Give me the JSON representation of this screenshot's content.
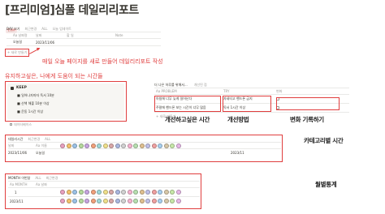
{
  "page": {
    "title": "[프리미엄]심플 데일리리포트",
    "tag": "T기반"
  },
  "daily_db": {
    "tabs": [
      "DAY 보기",
      "최근변경",
      "ALL",
      "오늘 업데이트"
    ],
    "columns": [
      "Aa 날짜명",
      "날짜",
      "할 일",
      "Note"
    ],
    "row": {
      "name": "오늘일",
      "date": "2023/11/06"
    },
    "new_label": "+ 새로 만들기"
  },
  "annotations": {
    "daily_page": "매일 오늘 페이지를 새로 만들어 데일리리포트 작성",
    "keep_time": "유지하고싶은, 나에게 도움이 되는 시간들",
    "improve_time": "개선하고싶은 시간",
    "improve_method": "개선방법",
    "change_record": "변화 기록하기",
    "category_time": "카테고리별 시간",
    "monthly": "월별통계"
  },
  "keep_panel": {
    "title": "KEEP",
    "items": [
      "일어나자마자 독서 10분",
      "산책 해볼 10분 이상",
      "운동 1시간 이상"
    ],
    "footer": "데이터베이스"
  },
  "problem_db": {
    "tabs": [
      "더 나은 하루를 위해서...",
      "개선된 점"
    ],
    "columns": [
      "Aa PROBLEM",
      "TRY",
      "변화"
    ],
    "rows": [
      {
        "problem": "아침에 너무 늦게 일어난다",
        "try": "자네티고 핸드폰 금지",
        "change": ""
      },
      {
        "problem": "주말에 핸드폰 보는 시간이 너무 많음",
        "try": "독서 1시간 이상",
        "change": ""
      }
    ],
    "new_label": "+ 새로 만들기"
  },
  "category_db": {
    "tabs": [
      "데일리시간",
      "최근변경",
      "ALL"
    ],
    "columns": [
      "날짜",
      "Aa 이름"
    ],
    "row": {
      "date": "2023/11/06",
      "name": "오늘일"
    },
    "total": "2023/11",
    "dot_colors": [
      "#e8a0bf",
      "#f5c26b",
      "#9bc2e6",
      "#b5d99c",
      "#c7a4e0",
      "#f2a07b",
      "#a0d8d8",
      "#f0e08a",
      "#d9a7a7",
      "#aab7e0",
      "#d2d2d2",
      "#f7b3d0",
      "#b8e0b0",
      "#e0c090",
      "#c0c0e8",
      "#f0a0a0",
      "#a8d0f0",
      "#d8c8a8",
      "#c8e8a8",
      "#e8b8e8"
    ]
  },
  "monthly_db": {
    "tabs": [
      "MONTH 이번달",
      "ALL",
      "최근변경"
    ],
    "columns": [
      "Aa MONTH",
      "Aa 날짜"
    ],
    "rows": [
      {
        "month": "1",
        "name": ""
      },
      {
        "month": "2023/11",
        "name": ""
      }
    ],
    "dot_colors": [
      "#e8a0bf",
      "#f5c26b",
      "#9bc2e6",
      "#b5d99c",
      "#c7a4e0",
      "#f2a07b",
      "#a0d8d8",
      "#f0e08a",
      "#d9a7a7",
      "#aab7e0",
      "#d2d2d2",
      "#f7b3d0",
      "#b8e0b0",
      "#e0c090",
      "#c0c0e8",
      "#f0a0a0",
      "#a8d0f0",
      "#d8c8a8",
      "#c8e8a8",
      "#e8b8e8"
    ]
  }
}
